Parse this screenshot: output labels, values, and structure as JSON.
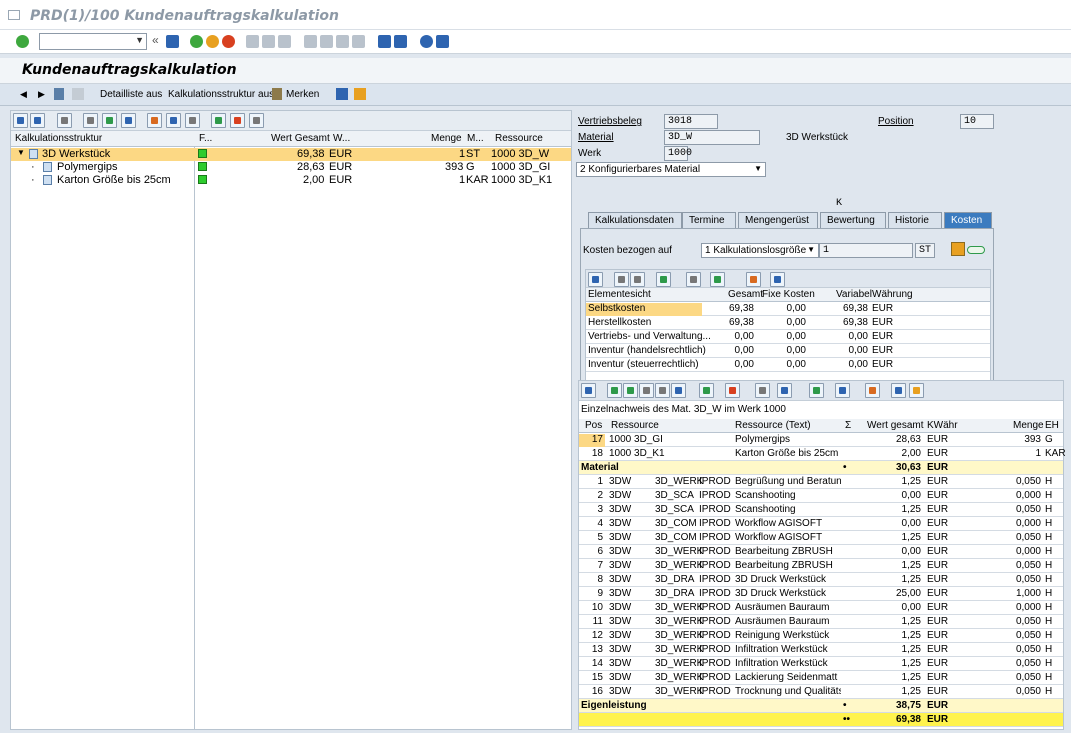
{
  "window": {
    "title": "PRD(1)/100 Kundenauftragskalkulation"
  },
  "app": {
    "title": "Kundenauftragskalkulation"
  },
  "app_toolbar": {
    "detail": "Detailliste aus",
    "structure": "Kalkulationsstruktur aus",
    "merken": "Merken"
  },
  "tree": {
    "headers": {
      "struct": "Kalkulationsstruktur",
      "f": "F...",
      "wert": "Wert Gesamt",
      "w": "W...",
      "menge": "Menge",
      "m": "M...",
      "ressource": "Ressource"
    },
    "rows": [
      {
        "name": "3D Werkstück",
        "wert": "69,38",
        "cur": "EUR",
        "menge": "1",
        "me": "ST",
        "res": "1000 3D_W"
      },
      {
        "name": "Polymergips",
        "wert": "28,63",
        "cur": "EUR",
        "menge": "393",
        "me": "G",
        "res": "1000 3D_GI"
      },
      {
        "name": "Karton Größe bis 25cm",
        "wert": "2,00",
        "cur": "EUR",
        "menge": "1",
        "me": "KAR",
        "res": "1000 3D_K1"
      }
    ]
  },
  "header_fields": {
    "vertriebsbeleg_label": "Vertriebsbeleg",
    "vertriebsbeleg": "3018",
    "position_label": "Position",
    "position": "10",
    "material_label": "Material",
    "material": "3D_W",
    "material_text": "3D Werkstück",
    "werk_label": "Werk",
    "werk": "1000",
    "config": "2 Konfigurierbares Material",
    "k_marker": "K"
  },
  "tabs": [
    "Kalkulationsdaten",
    "Termine",
    "Mengengerüst",
    "Bewertung",
    "Historie",
    "Kosten"
  ],
  "kosten": {
    "bezogen_label": "Kosten bezogen auf",
    "bezogen_value": "1 Kalkulationslosgröße",
    "qty": "1",
    "unit": "ST",
    "headers": {
      "element": "Elementesicht",
      "gesamt": "Gesamt",
      "fixe": "Fixe Kosten",
      "variabel": "Variabel",
      "waehrung": "Währung"
    },
    "rows": [
      {
        "element": "Selbstkosten",
        "gesamt": "69,38",
        "fixe": "0,00",
        "variabel": "69,38",
        "w": "EUR"
      },
      {
        "element": "Herstellkosten",
        "gesamt": "69,38",
        "fixe": "0,00",
        "variabel": "69,38",
        "w": "EUR"
      },
      {
        "element": "Vertriebs- und Verwaltung...",
        "gesamt": "0,00",
        "fixe": "0,00",
        "variabel": "0,00",
        "w": "EUR"
      },
      {
        "element": "Inventur (handelsrechtlich)",
        "gesamt": "0,00",
        "fixe": "0,00",
        "variabel": "0,00",
        "w": "EUR"
      },
      {
        "element": "Inventur (steuerrechtlich)",
        "gesamt": "0,00",
        "fixe": "0,00",
        "variabel": "0,00",
        "w": "EUR"
      }
    ]
  },
  "detail": {
    "title": "Einzelnachweis des Mat. 3D_W im Werk 1000",
    "headers": {
      "pos": "Pos",
      "res": "Ressource",
      "res_text": "Ressource (Text)",
      "sigma": "Σ",
      "wert": "Wert gesamt",
      "kwaehr": "KWähr",
      "menge": "Menge",
      "eh": "EH"
    },
    "material_rows": [
      {
        "pos": "17",
        "res": "1000 3D_GI",
        "text": "Polymergips",
        "wert": "28,63",
        "kw": "EUR",
        "menge": "393",
        "eh": "G"
      },
      {
        "pos": "18",
        "res": "1000 3D_K1",
        "text": "Karton Größe bis 25cm",
        "wert": "2,00",
        "kw": "EUR",
        "menge": "1",
        "eh": "KAR"
      }
    ],
    "material_sum": {
      "label": "Material",
      "dot": "•",
      "wert": "30,63",
      "kw": "EUR"
    },
    "ek_rows": [
      {
        "pos": "1",
        "a": "3DW",
        "b": "3D_WERK",
        "c": "IPROD",
        "text": "Begrüßung und Beratung",
        "wert": "1,25",
        "kw": "EUR",
        "menge": "0,050",
        "eh": "H"
      },
      {
        "pos": "2",
        "a": "3DW",
        "b": "3D_SCA",
        "c": "IPROD",
        "text": "Scanshooting",
        "wert": "0,00",
        "kw": "EUR",
        "menge": "0,000",
        "eh": "H"
      },
      {
        "pos": "3",
        "a": "3DW",
        "b": "3D_SCA",
        "c": "IPROD",
        "text": "Scanshooting",
        "wert": "1,25",
        "kw": "EUR",
        "menge": "0,050",
        "eh": "H"
      },
      {
        "pos": "4",
        "a": "3DW",
        "b": "3D_COM",
        "c": "IPROD",
        "text": "Workflow AGISOFT",
        "wert": "0,00",
        "kw": "EUR",
        "menge": "0,000",
        "eh": "H"
      },
      {
        "pos": "5",
        "a": "3DW",
        "b": "3D_COM",
        "c": "IPROD",
        "text": "Workflow AGISOFT",
        "wert": "1,25",
        "kw": "EUR",
        "menge": "0,050",
        "eh": "H"
      },
      {
        "pos": "6",
        "a": "3DW",
        "b": "3D_WERK",
        "c": "IPROD",
        "text": "Bearbeitung ZBRUSH",
        "wert": "0,00",
        "kw": "EUR",
        "menge": "0,000",
        "eh": "H"
      },
      {
        "pos": "7",
        "a": "3DW",
        "b": "3D_WERK",
        "c": "IPROD",
        "text": "Bearbeitung ZBRUSH",
        "wert": "1,25",
        "kw": "EUR",
        "menge": "0,050",
        "eh": "H"
      },
      {
        "pos": "8",
        "a": "3DW",
        "b": "3D_DRA",
        "c": "IPROD",
        "text": "3D Druck Werkstück",
        "wert": "1,25",
        "kw": "EUR",
        "menge": "0,050",
        "eh": "H"
      },
      {
        "pos": "9",
        "a": "3DW",
        "b": "3D_DRA",
        "c": "IPROD",
        "text": "3D Druck Werkstück",
        "wert": "25,00",
        "kw": "EUR",
        "menge": "1,000",
        "eh": "H"
      },
      {
        "pos": "10",
        "a": "3DW",
        "b": "3D_WERK",
        "c": "IPROD",
        "text": "Ausräumen Bauraum",
        "wert": "0,00",
        "kw": "EUR",
        "menge": "0,000",
        "eh": "H"
      },
      {
        "pos": "11",
        "a": "3DW",
        "b": "3D_WERK",
        "c": "IPROD",
        "text": "Ausräumen Bauraum",
        "wert": "1,25",
        "kw": "EUR",
        "menge": "0,050",
        "eh": "H"
      },
      {
        "pos": "12",
        "a": "3DW",
        "b": "3D_WERK",
        "c": "IPROD",
        "text": "Reinigung Werkstück",
        "wert": "1,25",
        "kw": "EUR",
        "menge": "0,050",
        "eh": "H"
      },
      {
        "pos": "13",
        "a": "3DW",
        "b": "3D_WERK",
        "c": "IPROD",
        "text": "Infiltration Werkstück",
        "wert": "1,25",
        "kw": "EUR",
        "menge": "0,050",
        "eh": "H"
      },
      {
        "pos": "14",
        "a": "3DW",
        "b": "3D_WERK",
        "c": "IPROD",
        "text": "Infiltration Werkstück",
        "wert": "1,25",
        "kw": "EUR",
        "menge": "0,050",
        "eh": "H"
      },
      {
        "pos": "15",
        "a": "3DW",
        "b": "3D_WERK",
        "c": "IPROD",
        "text": "Lackierung Seidenmatt ...",
        "wert": "1,25",
        "kw": "EUR",
        "menge": "0,050",
        "eh": "H"
      },
      {
        "pos": "16",
        "a": "3DW",
        "b": "3D_WERK",
        "c": "IPROD",
        "text": "Trocknung und Qualitäts...",
        "wert": "1,25",
        "kw": "EUR",
        "menge": "0,050",
        "eh": "H"
      }
    ],
    "ek_sum": {
      "label": "Eigenleistung",
      "dot": "•",
      "wert": "38,75",
      "kw": "EUR"
    },
    "total": {
      "dot": "••",
      "wert": "69,38",
      "kw": "EUR"
    }
  },
  "colors": {
    "selected": "#fcd884",
    "sum": "#fff8c8",
    "total": "#fff34d",
    "tab_active": "#3b7bbf"
  }
}
